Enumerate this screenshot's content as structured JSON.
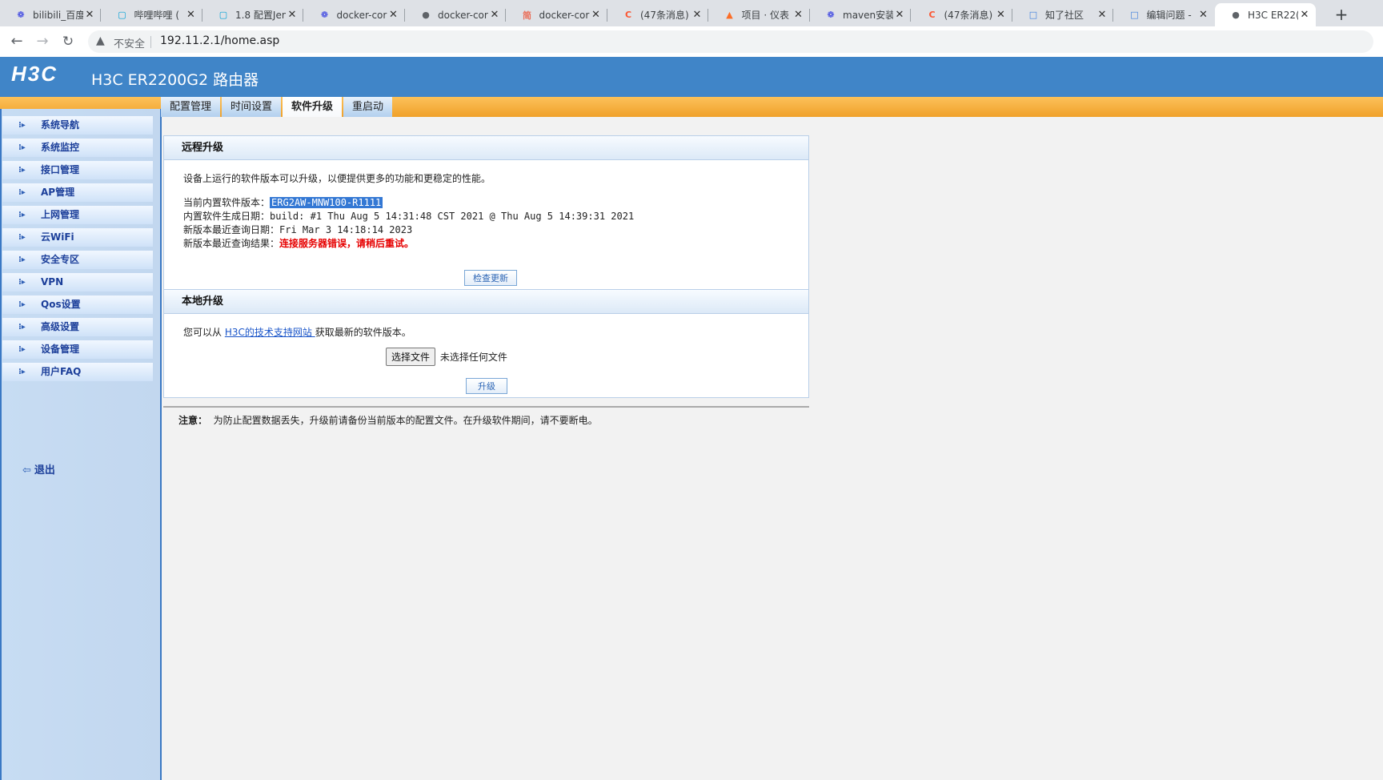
{
  "browser": {
    "tabs": [
      {
        "title": "bilibili_百度",
        "icon": "baidu-paw-icon",
        "icon_color": "#2932e1"
      },
      {
        "title": "哔哩哔哩 (",
        "icon": "bilibili-tv-icon",
        "icon_color": "#00a1d6"
      },
      {
        "title": "1.8 配置Jen",
        "icon": "bilibili-tv-icon",
        "icon_color": "#00a1d6"
      },
      {
        "title": "docker-cor",
        "icon": "baidu-paw-icon",
        "icon_color": "#2932e1"
      },
      {
        "title": "docker-cor",
        "icon": "globe-icon",
        "icon_color": "#5f6368"
      },
      {
        "title": "docker-cor",
        "icon": "jianshu-icon",
        "icon_color": "#ea6f5a"
      },
      {
        "title": "(47条消息)",
        "icon": "csdn-icon",
        "icon_color": "#fc5531"
      },
      {
        "title": "项目 · 仪表",
        "icon": "gitlab-fox-icon",
        "icon_color": "#fc6d26"
      },
      {
        "title": "maven安装",
        "icon": "baidu-paw-icon",
        "icon_color": "#2932e1"
      },
      {
        "title": "(47条消息)",
        "icon": "csdn-icon",
        "icon_color": "#fc5531"
      },
      {
        "title": "知了社区",
        "icon": "zhiliao-icon",
        "icon_color": "#3b7ddd"
      },
      {
        "title": "编辑问题 -",
        "icon": "zhiliao-icon",
        "icon_color": "#3b7ddd"
      },
      {
        "title": "H3C ER22(",
        "icon": "globe-icon",
        "icon_color": "#5f6368",
        "active": true
      }
    ],
    "insecure_label": "不安全",
    "url": "192.11.2.1/home.asp"
  },
  "header": {
    "logo_text": "H3C",
    "product_title": "H3C ER2200G2 路由器"
  },
  "sidebar": {
    "items": [
      {
        "label": "系统导航"
      },
      {
        "label": "系统监控"
      },
      {
        "label": "接口管理"
      },
      {
        "label": "AP管理"
      },
      {
        "label": "上网管理"
      },
      {
        "label": "云WiFi"
      },
      {
        "label": "安全专区"
      },
      {
        "label": "VPN"
      },
      {
        "label": "Qos设置"
      },
      {
        "label": "高级设置"
      },
      {
        "label": "设备管理"
      },
      {
        "label": "用户FAQ"
      }
    ],
    "logout_label": "退出"
  },
  "subtabs": [
    {
      "label": "配置管理"
    },
    {
      "label": "时间设置"
    },
    {
      "label": "软件升级",
      "active": true
    },
    {
      "label": "重启动"
    }
  ],
  "remote": {
    "heading": "远程升级",
    "intro": "设备上运行的软件版本可以升级，以便提供更多的功能和更稳定的性能。",
    "current_version_label": "当前内置软件版本：",
    "current_version": "ERG2AW-MNW100-R1111",
    "build_date_label": "内置软件生成日期：",
    "build_date": "build: #1 Thu Aug 5 14:31:48 CST 2021 @ Thu Aug 5 14:39:31 2021",
    "last_query_date_label": "新版本最近查询日期：",
    "last_query_date": "Fri Mar 3 14:18:14 2023",
    "last_query_result_label": "新版本最近查询结果：",
    "last_query_result": "连接服务器错误，请稍后重试。",
    "check_update_button": "检查更新"
  },
  "local": {
    "heading": "本地升级",
    "text_before": "您可以从 ",
    "link": "H3C的技术支持网站 ",
    "text_after": "获取最新的软件版本。",
    "choose_file_button": "选择文件",
    "no_file": "未选择任何文件",
    "upgrade_button": "升级"
  },
  "note": {
    "label": "注意：",
    "text": "为防止配置数据丢失，升级前请备份当前版本的配置文件。在升级软件期间，请不要断电。"
  },
  "colors": {
    "header_blue": "#4085c8",
    "error_red": "#e60000",
    "selection_blue": "#3478d4",
    "link_blue": "#1a55c9"
  }
}
